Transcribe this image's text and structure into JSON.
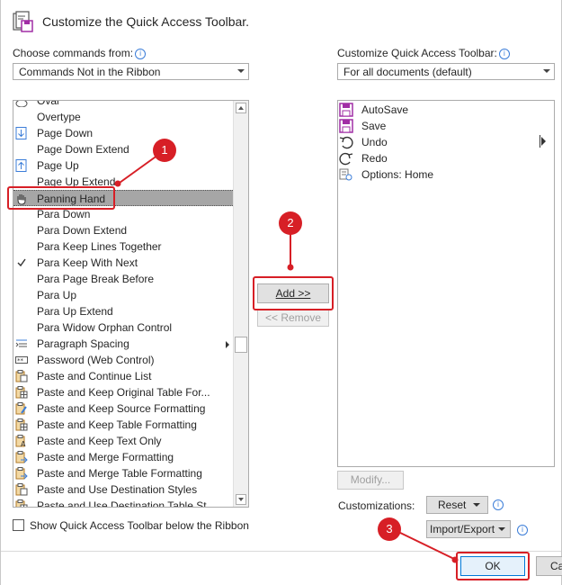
{
  "header": {
    "title": "Customize the Quick Access Toolbar."
  },
  "left": {
    "choose_label": "Choose commands from:",
    "choose_value": "Commands Not in the Ribbon",
    "items": [
      {
        "label": "Oval",
        "icon": "oval-icon"
      },
      {
        "label": "Overtype",
        "icon": ""
      },
      {
        "label": "Page Down",
        "icon": "arrow-down-icon"
      },
      {
        "label": "Page Down Extend",
        "icon": ""
      },
      {
        "label": "Page Up",
        "icon": "arrow-up-icon"
      },
      {
        "label": "Page Up Extend",
        "icon": ""
      },
      {
        "label": "Panning Hand",
        "icon": "hand-icon",
        "selected": true
      },
      {
        "label": "Para Down",
        "icon": ""
      },
      {
        "label": "Para Down Extend",
        "icon": ""
      },
      {
        "label": "Para Keep Lines Together",
        "icon": ""
      },
      {
        "label": "Para Keep With Next",
        "icon": "check-icon"
      },
      {
        "label": "Para Page Break Before",
        "icon": ""
      },
      {
        "label": "Para Up",
        "icon": ""
      },
      {
        "label": "Para Up Extend",
        "icon": ""
      },
      {
        "label": "Para Widow Orphan Control",
        "icon": ""
      },
      {
        "label": "Paragraph Spacing",
        "icon": "paragraph-spacing-icon",
        "submenu": true
      },
      {
        "label": "Password (Web Control)",
        "icon": "password-icon"
      },
      {
        "label": "Paste and Continue List",
        "icon": "paste-icon"
      },
      {
        "label": "Paste and Keep Original Table For...",
        "icon": "paste-table-icon"
      },
      {
        "label": "Paste and Keep Source Formatting",
        "icon": "paste-brush-icon"
      },
      {
        "label": "Paste and Keep Table Formatting",
        "icon": "paste-table-icon"
      },
      {
        "label": "Paste and Keep Text Only",
        "icon": "paste-text-icon"
      },
      {
        "label": "Paste and Merge Formatting",
        "icon": "paste-merge-icon"
      },
      {
        "label": "Paste and Merge Table Formatting",
        "icon": "paste-merge-icon"
      },
      {
        "label": "Paste and Use Destination Styles",
        "icon": "paste-icon"
      },
      {
        "label": "Paste and Use Destination Table St...",
        "icon": "paste-table-icon"
      }
    ],
    "show_below_label": "Show Quick Access Toolbar below the Ribbon"
  },
  "middle": {
    "add_label": "Add >>",
    "remove_label": "<< Remove"
  },
  "right": {
    "customize_label": "Customize Quick Access Toolbar:",
    "customize_value": "For all documents (default)",
    "items": [
      {
        "label": "AutoSave",
        "icon": "autosave-icon"
      },
      {
        "label": "Save",
        "icon": "save-icon"
      },
      {
        "label": "Undo",
        "icon": "undo-icon"
      },
      {
        "label": "Redo",
        "icon": "redo-icon"
      },
      {
        "label": "Options: Home",
        "icon": "options-icon"
      }
    ],
    "modify_label": "Modify...",
    "customizations_label": "Customizations:",
    "reset_label": "Reset",
    "import_export_label": "Import/Export"
  },
  "footer": {
    "ok_label": "OK",
    "cancel_label": "Ca"
  },
  "annotations": {
    "c1": "1",
    "c2": "2",
    "c3": "3"
  },
  "colors": {
    "accent_red": "#d71f26",
    "save_purple": "#a12ea5"
  }
}
